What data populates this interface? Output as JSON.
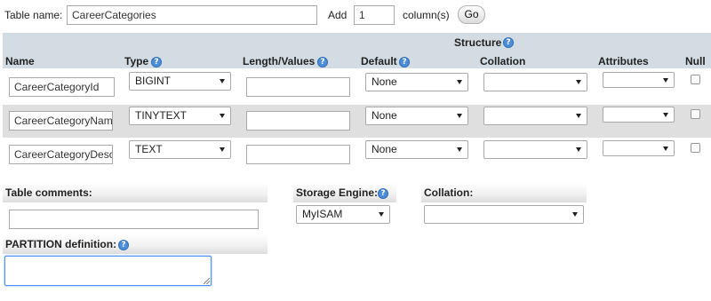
{
  "top_bar": {
    "table_name_label": "Table name:",
    "table_name_value": "CareerCategories",
    "add_label": "Add",
    "add_count": "1",
    "columns_label": "column(s)",
    "go_label": "Go"
  },
  "structure": {
    "title": "Structure",
    "headers": {
      "name": "Name",
      "type": "Type",
      "length": "Length/Values",
      "default": "Default",
      "collation": "Collation",
      "attributes": "Attributes",
      "null": "Null"
    },
    "rows": [
      {
        "name": "CareerCategoryId",
        "type": "BIGINT",
        "length": "",
        "default": "None",
        "collation": "",
        "attributes": "",
        "null": false
      },
      {
        "name": "CareerCategoryName",
        "type": "TINYTEXT",
        "length": "",
        "default": "None",
        "collation": "",
        "attributes": "",
        "null": false
      },
      {
        "name": "CareerCategoryDesc",
        "type": "TEXT",
        "length": "",
        "default": "None",
        "collation": "",
        "attributes": "",
        "null": false
      }
    ]
  },
  "table_options": {
    "table_comments_label": "Table comments:",
    "table_comments_value": "",
    "storage_engine_label": "Storage Engine:",
    "storage_engine_value": "MyISAM",
    "collation_label": "Collation:",
    "collation_value": "",
    "partition_label": "PARTITION definition:",
    "partition_value": ""
  },
  "colors": {
    "header_band": "#d3dce3",
    "row_alt": "#dfdfdf",
    "help_icon": "#4d8ed8",
    "focus_border": "#4d90fe"
  },
  "icons": {
    "help": "help-circle-icon",
    "dropdown": "chevron-down-icon"
  }
}
